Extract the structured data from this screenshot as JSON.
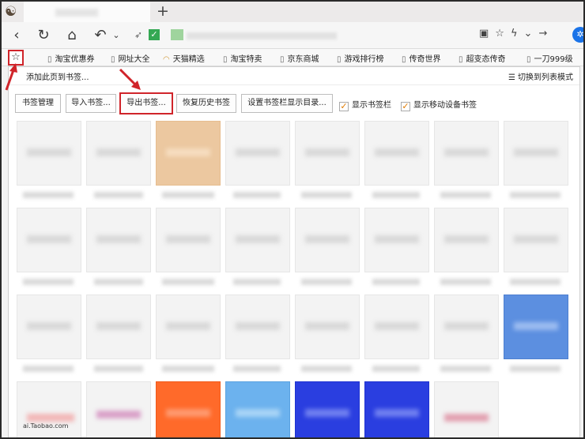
{
  "browser": {
    "toolbar_icons": [
      "back-icon",
      "refresh-icon",
      "home-icon",
      "undo-icon",
      "menu-chevron-icon"
    ],
    "url_action_icons": [
      "qr-code-icon",
      "star-icon",
      "bolt-icon",
      "chevron-down-icon",
      "forward-icon"
    ]
  },
  "bookmarks_bar": [
    {
      "label": "淘宝优惠券"
    },
    {
      "label": "网址大全"
    },
    {
      "label": "天猫精选"
    },
    {
      "label": "淘宝特卖"
    },
    {
      "label": "京东商城"
    },
    {
      "label": "游戏排行榜"
    },
    {
      "label": "传奇世界"
    },
    {
      "label": "超变态传奇"
    },
    {
      "label": "一刀999级"
    }
  ],
  "panel": {
    "add_page": "添加此页到书签...",
    "switch_list": "切换到列表模式",
    "buttons": {
      "manage": "书签管理",
      "import": "导入书签...",
      "export": "导出书签...",
      "restore": "恢复历史书签",
      "settings": "设置书签栏显示目录..."
    },
    "checkboxes": {
      "show_bar": "显示书签栏",
      "show_mobile": "显示移动设备书签"
    },
    "last_caption": "ai.Taobao.com"
  },
  "colors": {
    "highlight": "#d0242a",
    "check": "#e07b00",
    "thumb_tan": "#ecc8a0",
    "thumb_blue": "#5c8fe0",
    "thumb_orange": "#ff6a2a",
    "thumb_lightblue": "#6cb2ee",
    "thumb_royal": "#2a3ee0"
  }
}
